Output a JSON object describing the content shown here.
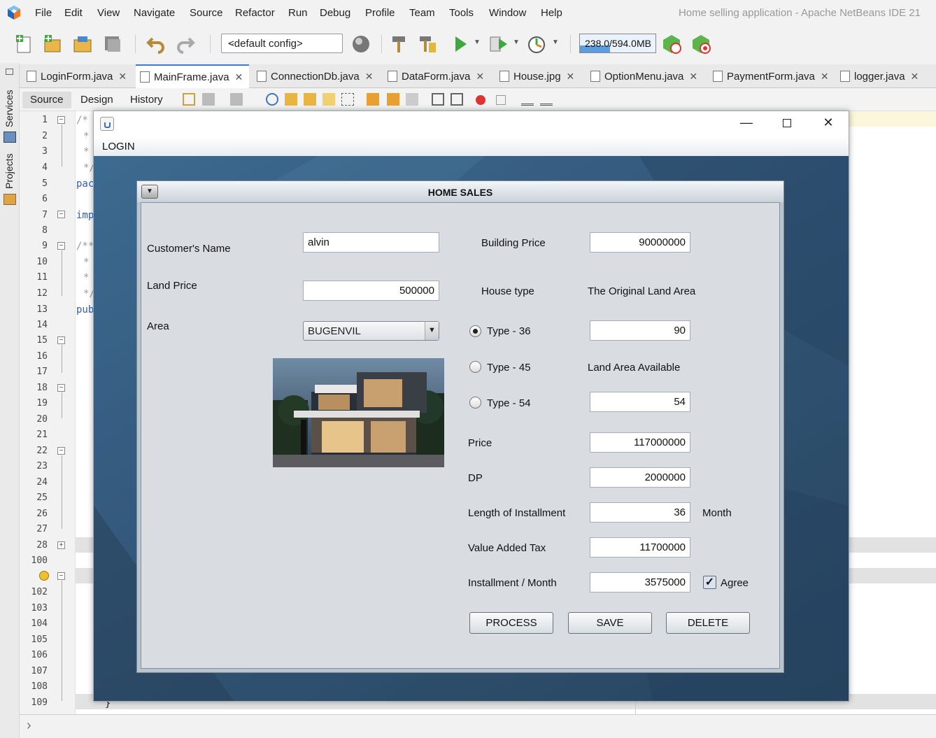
{
  "menubar": {
    "items": [
      "File",
      "Edit",
      "View",
      "Navigate",
      "Source",
      "Refactor",
      "Run",
      "Debug",
      "Profile",
      "Team",
      "Tools",
      "Window",
      "Help"
    ],
    "window_title": "Home selling application - Apache NetBeans IDE 21"
  },
  "toolbar": {
    "config": "<default config>",
    "memory": "238.0/594.0MB",
    "memory_fraction": 0.4
  },
  "side": {
    "services": "Services",
    "projects": "Projects"
  },
  "tabs": [
    {
      "label": "LoginForm.java"
    },
    {
      "label": "MainFrame.java",
      "active": true
    },
    {
      "label": "ConnectionDb.java"
    },
    {
      "label": "DataForm.java"
    },
    {
      "label": "House.jpg"
    },
    {
      "label": "OptionMenu.java"
    },
    {
      "label": "PaymentForm.java"
    },
    {
      "label": "logger.java"
    }
  ],
  "editor_views": {
    "source": "Source",
    "design": "Design",
    "history": "History"
  },
  "line_numbers": [
    "1",
    "2",
    "3",
    "4",
    "5",
    "6",
    "7",
    "8",
    "9",
    "10",
    "11",
    "12",
    "13",
    "14",
    "15",
    "16",
    "17",
    "18",
    "19",
    "20",
    "21",
    "22",
    "23",
    "24",
    "25",
    "26",
    "27",
    "28",
    "100",
    "",
    "102",
    "103",
    "104",
    "105",
    "106",
    "107",
    "108",
    "109"
  ],
  "code_fragments": {
    "l1": "/*",
    "l2": "*",
    "l3": "*",
    "l4": "*/",
    "l5": "pac",
    "l7": "imp",
    "l9": "/**",
    "l10": "*",
    "l11": "*",
    "l12": "*/",
    "l13": "pub",
    "l109": "}"
  },
  "frame": {
    "menu_login": "LOGIN"
  },
  "form": {
    "title": "HOME SALES",
    "customer_label": "Customer's Name",
    "customer_value": "alvin",
    "land_price_label": "Land Price",
    "land_price_value": "500000",
    "area_label": "Area",
    "area_value": "BUGENVIL",
    "building_price_label": "Building Price",
    "building_price_value": "90000000",
    "house_type_label": "House type",
    "original_land_label": "The Original Land Area",
    "original_land_value": "90",
    "types": [
      "Type - 36",
      "Type - 45",
      "Type - 54"
    ],
    "selected_type": "Type - 36",
    "land_available_label": "Land Area Available",
    "land_available_value": "54",
    "price_label": "Price",
    "price_value": "117000000",
    "dp_label": "DP",
    "dp_value": "2000000",
    "length_label": "Length of Installment",
    "length_value": "36",
    "month_label": "Month",
    "vat_label": "Value Added Tax",
    "vat_value": "11700000",
    "installment_label": "Installment / Month",
    "installment_value": "3575000",
    "agree_label": "Agree",
    "agree_checked": true,
    "process_button": "PROCESS",
    "save_button": "SAVE",
    "delete_button": "DELETE"
  }
}
